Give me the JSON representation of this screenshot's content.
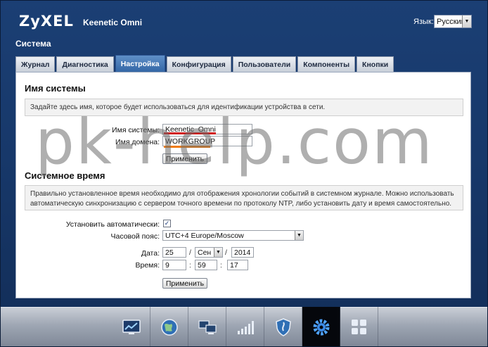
{
  "header": {
    "brand": "ZyXEL",
    "model": "Keenetic Omni",
    "language_label": "Язык:",
    "language_value": "Русский"
  },
  "section_title": "Система",
  "tabs": [
    {
      "label": "Журнал",
      "active": false
    },
    {
      "label": "Диагностика",
      "active": false
    },
    {
      "label": "Настройка",
      "active": true
    },
    {
      "label": "Конфигурация",
      "active": false
    },
    {
      "label": "Пользователи",
      "active": false
    },
    {
      "label": "Компоненты",
      "active": false
    },
    {
      "label": "Кнопки",
      "active": false
    }
  ],
  "system_name": {
    "heading": "Имя системы",
    "note": "Задайте здесь имя, которое будет использоваться для идентификации устройства в сети.",
    "name_label": "Имя системы:",
    "name_value": "Keenetic_Omni",
    "domain_label": "Имя домена:",
    "domain_value": "WORKGROUP",
    "apply_label": "Применить",
    "name_underline_color": "#d11a1a",
    "domain_underline_color": "#f07c12"
  },
  "system_time": {
    "heading": "Системное время",
    "note": "Правильно установленное время необходимо для отображения хронологии событий в системном журнале. Можно использовать автоматическую синхронизацию с сервером точного времени по протоколу NTP, либо установить дату и время самостоятельно.",
    "auto_label": "Установить автоматически:",
    "auto_checked": true,
    "tz_label": "Часовой пояс:",
    "tz_value": "UTC+4  Europe/Moscow",
    "date_label": "Дата:",
    "day": "25",
    "month": "Сен",
    "year": "2014",
    "date_sep": "/",
    "time_label": "Время:",
    "hour": "9",
    "minute": "59",
    "second": "17",
    "time_sep": ":",
    "apply_label": "Применить"
  },
  "watermark": "pk-help.com",
  "bottom_icons": [
    {
      "name": "monitor-icon",
      "active": false
    },
    {
      "name": "internet-globe-icon",
      "active": false
    },
    {
      "name": "home-network-icon",
      "active": false
    },
    {
      "name": "wifi-signal-icon",
      "active": false
    },
    {
      "name": "security-shield-icon",
      "active": false
    },
    {
      "name": "system-gear-icon",
      "active": true
    },
    {
      "name": "applications-grid-icon",
      "active": false
    }
  ]
}
